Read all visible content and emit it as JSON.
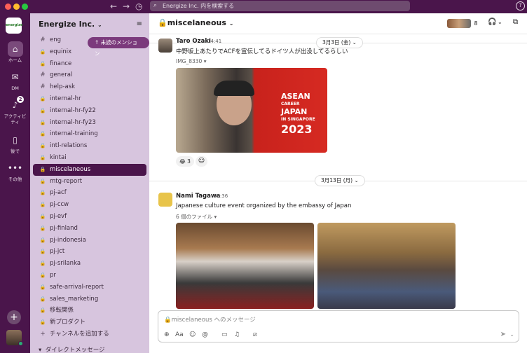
{
  "search": {
    "placeholder": "Energize Inc. 内を検索する"
  },
  "rail": {
    "logo_text": "energize",
    "items": [
      {
        "label": "ホーム"
      },
      {
        "label": "DM"
      },
      {
        "label": "アクティビティ",
        "badge": "2"
      },
      {
        "label": "後で"
      },
      {
        "label": "その他"
      }
    ]
  },
  "sidebar": {
    "workspace": "Energize Inc.",
    "mention_pill": "↑ 未読のメンション",
    "channels": [
      {
        "name": "eng",
        "prefix": "#"
      },
      {
        "name": "equinix",
        "prefix": "lock"
      },
      {
        "name": "finance",
        "prefix": "lock"
      },
      {
        "name": "general",
        "prefix": "#"
      },
      {
        "name": "help-ask",
        "prefix": "#"
      },
      {
        "name": "internal-hr",
        "prefix": "lock"
      },
      {
        "name": "internal-hr-fy22",
        "prefix": "lock"
      },
      {
        "name": "internal-hr-fy23",
        "prefix": "lock"
      },
      {
        "name": "internal-training",
        "prefix": "lock"
      },
      {
        "name": "intl-relations",
        "prefix": "lock"
      },
      {
        "name": "kintai",
        "prefix": "lock"
      },
      {
        "name": "miscelaneous",
        "prefix": "lock",
        "active": true
      },
      {
        "name": "mtg-report",
        "prefix": "lock"
      },
      {
        "name": "pj-acf",
        "prefix": "lock"
      },
      {
        "name": "pj-ccw",
        "prefix": "lock"
      },
      {
        "name": "pj-evf",
        "prefix": "lock"
      },
      {
        "name": "pj-finland",
        "prefix": "lock"
      },
      {
        "name": "pj-indonesia",
        "prefix": "lock"
      },
      {
        "name": "pj-jct",
        "prefix": "lock"
      },
      {
        "name": "pj-srilanka",
        "prefix": "lock"
      },
      {
        "name": "pr",
        "prefix": "lock"
      },
      {
        "name": "safe-arrival-report",
        "prefix": "lock"
      },
      {
        "name": "sales_marketing",
        "prefix": "lock"
      },
      {
        "name": "移転関係",
        "prefix": "lock"
      },
      {
        "name": "新プロダクト",
        "prefix": "lock"
      },
      {
        "name": "チャンネルを追加する",
        "prefix": "+"
      }
    ],
    "dm_header": "ダイレクトメッセージ"
  },
  "channel": {
    "name": "miscelaneous",
    "member_count": "8"
  },
  "messages": [
    {
      "day": "3月3日 (金)",
      "author": "Taro Ozaki",
      "time": "14:41",
      "text": "中野坂上あたりでACFを宣伝してるドイツ人が出没してるらしい",
      "file": "IMG_8330",
      "image_text": [
        "ASEAN",
        "CAREER",
        "JAPAN",
        "IN SINGAPORE",
        "2023"
      ],
      "reaction": {
        "emoji": "😂",
        "count": "3"
      }
    },
    {
      "day": "3月13日 (月)",
      "author": "Nami Tagawa",
      "time": "09:36",
      "text": "Japanese culture event organized by the embassy of Japan",
      "file": "6 個のファイル"
    }
  ],
  "composer": {
    "placeholder": "miscelaneous へのメッセージ"
  },
  "colors": {
    "aubergine": "#4a154b",
    "sidebar": "#d7c5de",
    "active": "#4a154b"
  }
}
